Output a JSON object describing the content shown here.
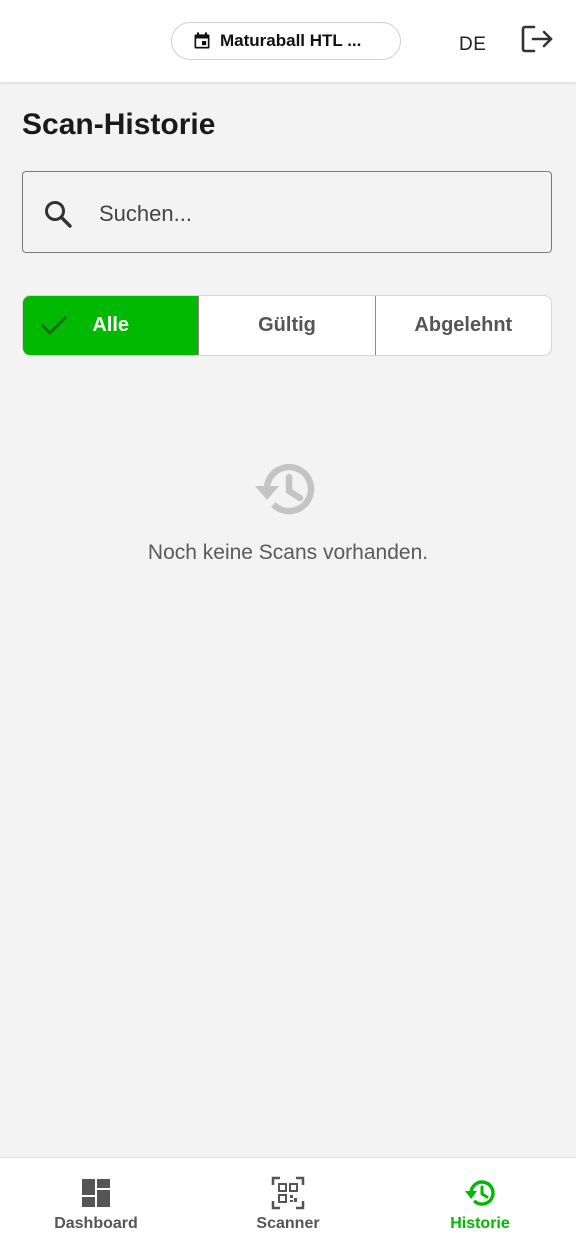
{
  "header": {
    "event_label": "Maturaball HTL ...",
    "language": "DE",
    "icons": {
      "event": "calendar-icon",
      "logout": "logout-icon"
    }
  },
  "page": {
    "title": "Scan-Historie"
  },
  "search": {
    "placeholder": "Suchen...",
    "value": ""
  },
  "filters": {
    "items": [
      {
        "label": "Alle",
        "active": true
      },
      {
        "label": "Gültig",
        "active": false
      },
      {
        "label": "Abgelehnt",
        "active": false
      }
    ]
  },
  "empty_state": {
    "icon": "history-icon",
    "message": "Noch keine Scans vorhanden."
  },
  "bottom_nav": {
    "items": [
      {
        "label": "Dashboard",
        "icon": "dashboard-icon",
        "active": false
      },
      {
        "label": "Scanner",
        "icon": "qr-scanner-icon",
        "active": false
      },
      {
        "label": "Historie",
        "icon": "history-icon",
        "active": true
      }
    ]
  },
  "colors": {
    "accent": "#00b900",
    "background": "#f3f3f3",
    "surface": "#ffffff",
    "muted_text": "#5a5a5a"
  }
}
